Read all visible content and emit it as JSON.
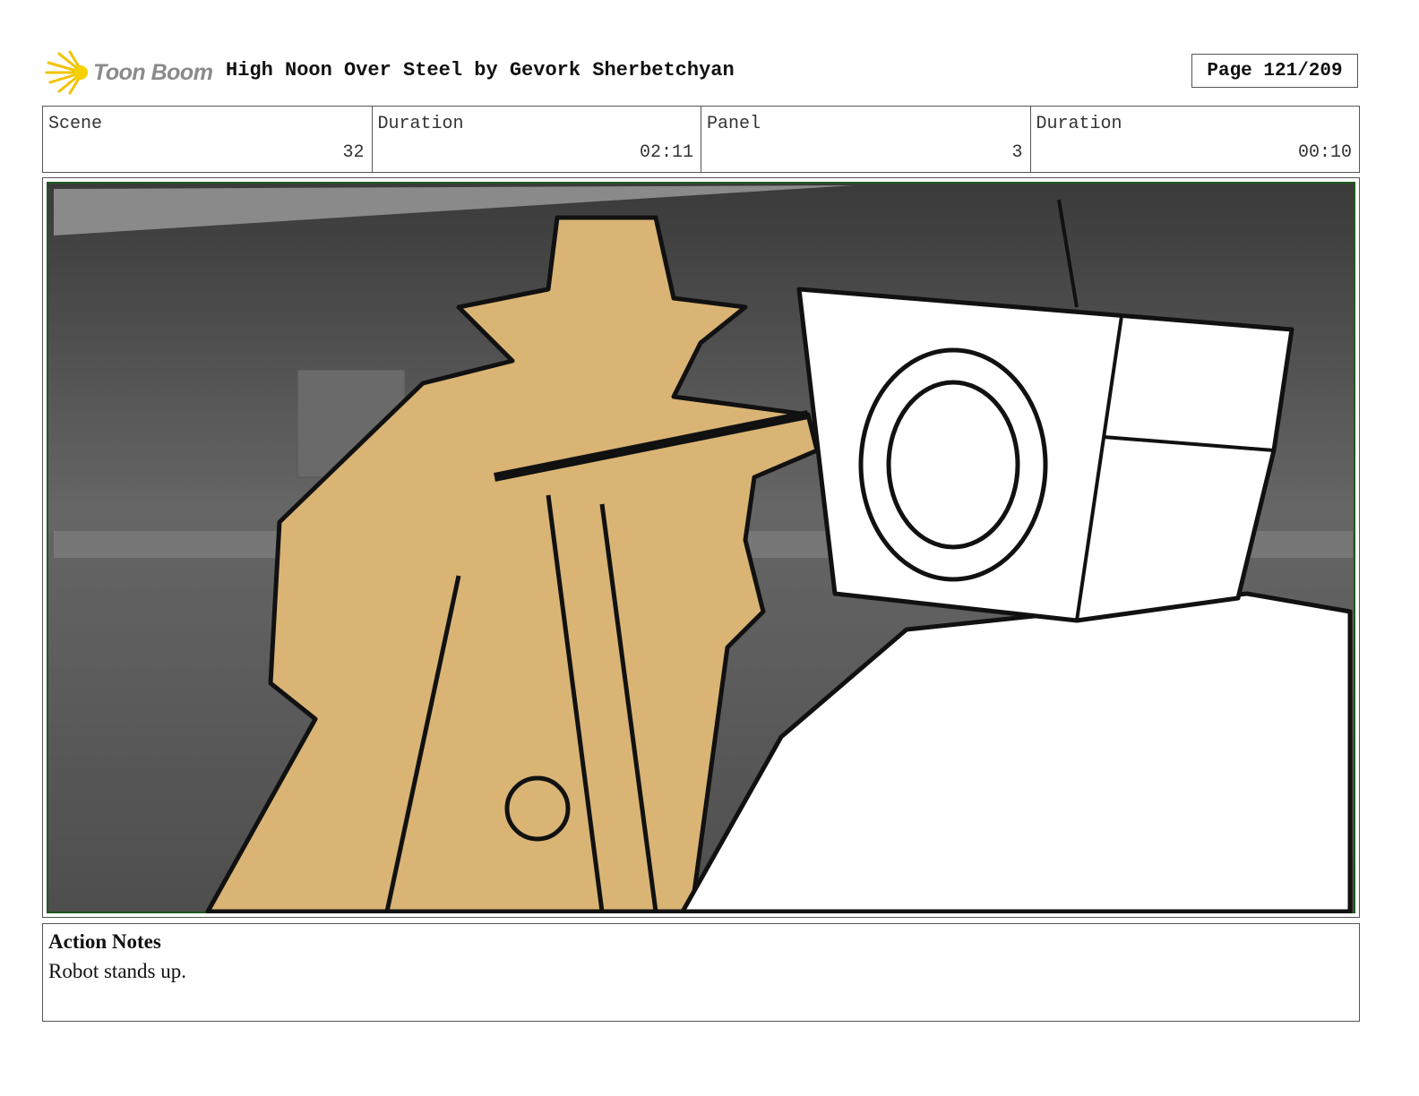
{
  "header": {
    "logo_text": "Toon Boom",
    "title": "High Noon Over Steel by Gevork Sherbetchyan",
    "page": "Page 121/209"
  },
  "info": [
    {
      "label": "Scene",
      "value": "32"
    },
    {
      "label": "Duration",
      "value": "02:11"
    },
    {
      "label": "Panel",
      "value": "3"
    },
    {
      "label": "Duration",
      "value": "00:10"
    }
  ],
  "notes": {
    "heading": "Action Notes",
    "text": "Robot stands up."
  },
  "colors": {
    "frame_border": "#1e5a1e",
    "tan": "#d9b475",
    "bg_gray": "#5a5a5a"
  }
}
